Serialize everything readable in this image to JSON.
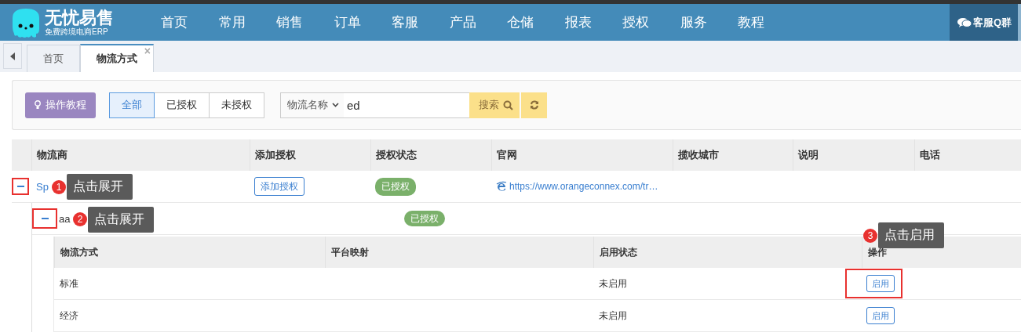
{
  "header": {
    "logo": {
      "title": "无忧易售",
      "subtitle": "免费跨境电商ERP"
    },
    "nav": [
      "首页",
      "常用",
      "销售",
      "订单",
      "客服",
      "产品",
      "仓储",
      "报表",
      "授权",
      "服务",
      "教程"
    ],
    "qq_group": "客服Q群"
  },
  "tabs": [
    {
      "label": "首页",
      "selected": false
    },
    {
      "label": "物流方式",
      "selected": true,
      "close": "×"
    }
  ],
  "toolbar": {
    "tutorial_button": "操作教程",
    "filters": [
      {
        "label": "全部",
        "selected": true
      },
      {
        "label": "已授权",
        "selected": false
      },
      {
        "label": "未授权",
        "selected": false
      }
    ],
    "search": {
      "field": "物流名称",
      "value": "ed",
      "button": "搜索"
    }
  },
  "table": {
    "columns": [
      "物流商",
      "添加授权",
      "授权状态",
      "官网",
      "揽收城市",
      "说明",
      "电话"
    ],
    "rows": [
      {
        "name": "Sp",
        "expanded": true,
        "highlighted": true,
        "annotation": {
          "number": "1",
          "text": "点击展开"
        },
        "add_button": "添加授权",
        "status": "已授权",
        "website": "https://www.orangeconnex.com/tr…",
        "children": [
          {
            "name": "aa",
            "expanded": true,
            "highlighted": true,
            "annotation": {
              "number": "2",
              "text": "点击展开"
            },
            "status": "已授权",
            "methods": {
              "columns": [
                "物流方式",
                "平台映射",
                "启用状态",
                "操作"
              ],
              "rows": [
                {
                  "method": "标准",
                  "status": "未启用",
                  "action": "启用",
                  "highlighted": true,
                  "annotation": {
                    "number": "3",
                    "text": "点击启用"
                  }
                },
                {
                  "method": "经济",
                  "status": "未启用",
                  "action": "启用",
                  "highlighted": false
                }
              ]
            }
          }
        ]
      }
    ]
  }
}
